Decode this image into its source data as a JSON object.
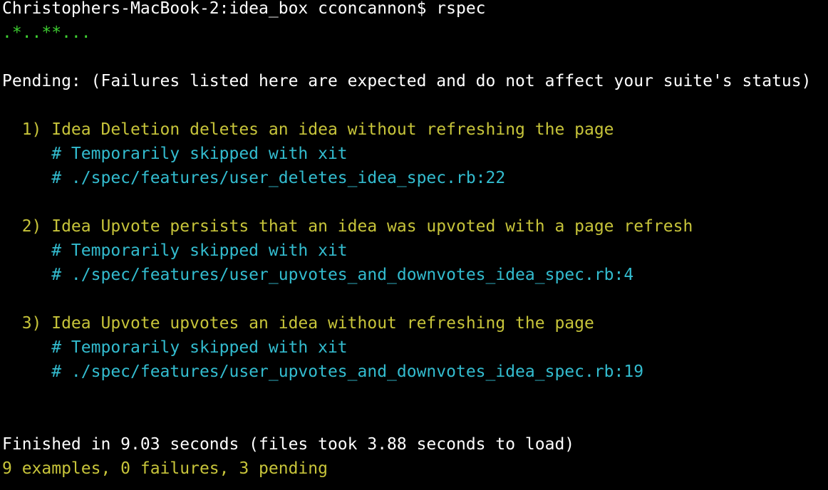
{
  "terminal": {
    "prompt": "Christophers-MacBook-2:idea_box cconcannon$ rspec",
    "progress": ".*..**...",
    "pending_header": "Pending: (Failures listed here are expected and do not affect your suite's status)",
    "pending_items": [
      {
        "title": "  1) Idea Deletion deletes an idea without refreshing the page",
        "reason": "     # Temporarily skipped with xit",
        "location": "     # ./spec/features/user_deletes_idea_spec.rb:22"
      },
      {
        "title": "  2) Idea Upvote persists that an idea was upvoted with a page refresh",
        "reason": "     # Temporarily skipped with xit",
        "location": "     # ./spec/features/user_upvotes_and_downvotes_idea_spec.rb:4"
      },
      {
        "title": "  3) Idea Upvote upvotes an idea without refreshing the page",
        "reason": "     # Temporarily skipped with xit",
        "location": "     # ./spec/features/user_upvotes_and_downvotes_idea_spec.rb:19"
      }
    ],
    "finished": "Finished in 9.03 seconds (files took 3.88 seconds to load)",
    "summary": "9 examples, 0 failures, 3 pending"
  },
  "colors": {
    "background": "#000000",
    "default_text": "#ffffff",
    "pending": "#c7c43a",
    "comment": "#33bccf",
    "progress": "#3ecf31"
  }
}
